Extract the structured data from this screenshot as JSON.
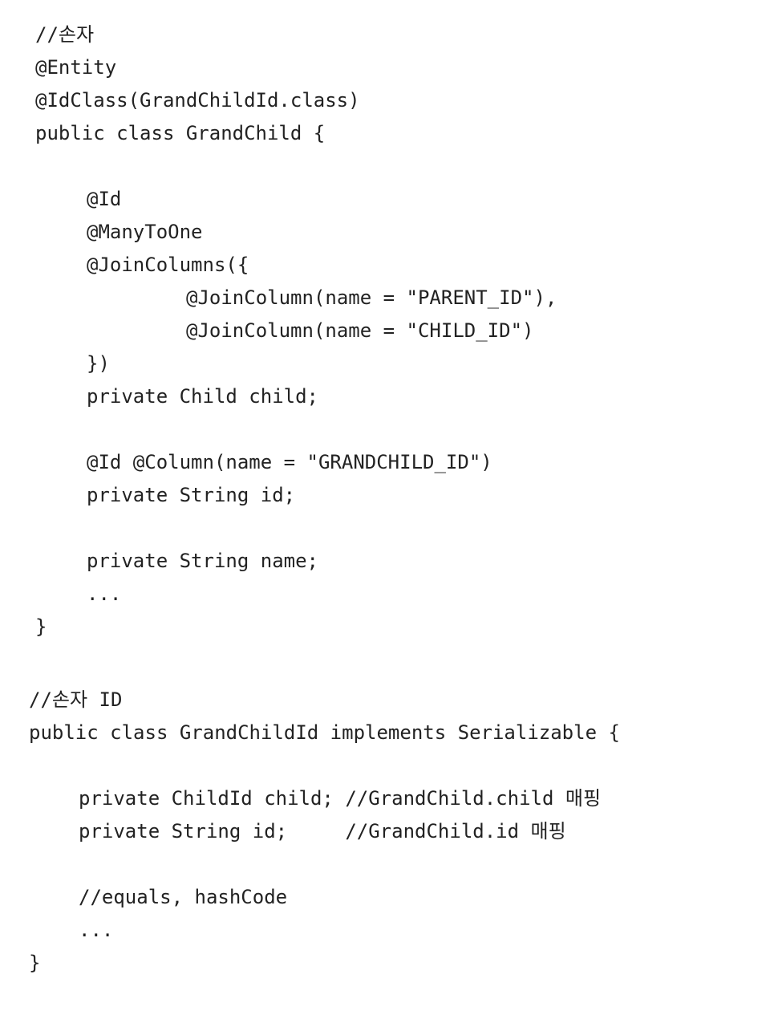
{
  "grandchild_class": {
    "lines": [
      "//손자",
      "@Entity",
      "@IdClass(GrandChildId.class)",
      "public class GrandChild {",
      "@Id",
      "@ManyToOne",
      "@JoinColumns({",
      "@JoinColumn(name = \"PARENT_ID\"),",
      "@JoinColumn(name = \"CHILD_ID\")",
      "})",
      "private Child child;",
      "@Id @Column(name = \"GRANDCHILD_ID\")",
      "private String id;",
      "private String name;",
      "...",
      "}"
    ]
  },
  "grandchildid_class": {
    "lines": [
      "//손자 ID",
      "public class GrandChildId implements Serializable {",
      "private ChildId child; //GrandChild.child 매핑",
      "private String id;     //GrandChild.id 매핑",
      "//equals, hashCode",
      "...",
      "}"
    ]
  }
}
